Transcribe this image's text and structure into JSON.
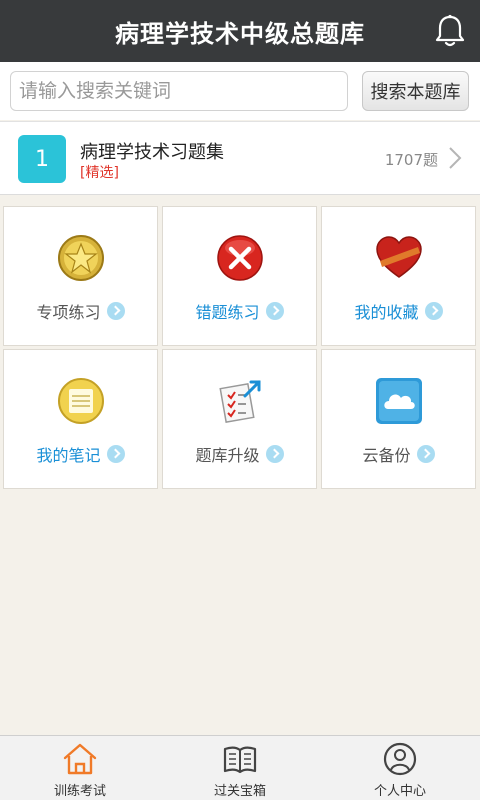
{
  "header": {
    "title": "病理学技术中级总题库",
    "icon": "bell-icon"
  },
  "search": {
    "placeholder": "请输入搜索关键词",
    "value": "",
    "button_label": "搜索本题库"
  },
  "bank": {
    "index": "1",
    "name": "病理学技术习题集",
    "tag": "[精选]",
    "count": "1707题"
  },
  "grid": {
    "items": [
      {
        "label": "专项练习",
        "icon": "star-badge-icon",
        "label_color": "gray"
      },
      {
        "label": "错题练习",
        "icon": "red-x-icon",
        "label_color": "blue"
      },
      {
        "label": "我的收藏",
        "icon": "heart-icon",
        "label_color": "blue"
      },
      {
        "label": "我的笔记",
        "icon": "notepad-icon",
        "label_color": "blue"
      },
      {
        "label": "题库升级",
        "icon": "checklist-upgrade-icon",
        "label_color": "gray"
      },
      {
        "label": "云备份",
        "icon": "cloud-icon",
        "label_color": "gray"
      }
    ]
  },
  "tabbar": {
    "items": [
      {
        "label": "训练考试",
        "icon": "home-icon",
        "active": true
      },
      {
        "label": "过关宝箱",
        "icon": "book-icon",
        "active": false
      },
      {
        "label": "个人中心",
        "icon": "user-icon",
        "active": false
      }
    ]
  },
  "colors": {
    "header_bg": "#383a3c",
    "accent_cyan": "#2bc3d8",
    "link_blue": "#1a8fd6",
    "tag_red": "#e0352b",
    "active_tab": "#f07a28"
  }
}
